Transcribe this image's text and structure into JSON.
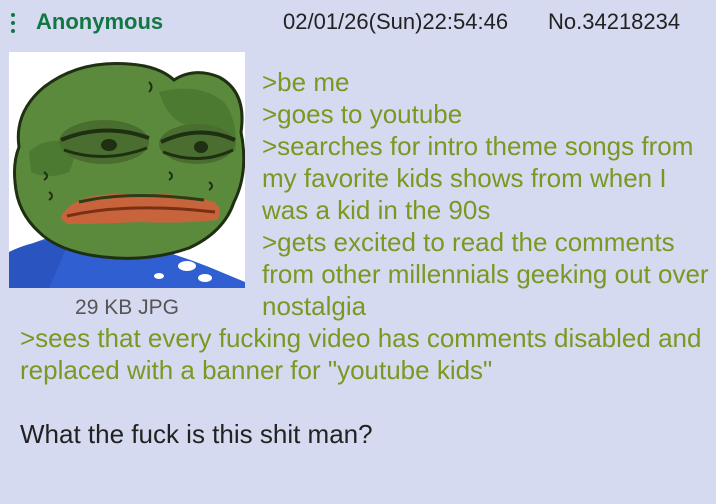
{
  "post": {
    "name": "Anonymous",
    "datetime": "02/01/26(Sun)22:54:46",
    "number": "No.34218234",
    "file_info": "29 KB JPG",
    "lines": [
      ">be me",
      ">goes to youtube",
      ">searches for intro theme songs from my favorite kids shows from when I was a kid in the 90s",
      ">gets excited to read the comments from other millennials geeking out over nostalgia",
      ">sees that every fucking video has comments disabled and replaced with a banner for \"youtube kids\""
    ],
    "closing": "What the fuck is this shit man?"
  },
  "colors": {
    "background": "#d6daf0",
    "name": "#117743",
    "greentext": "#789922",
    "text": "#222222"
  },
  "icons": {
    "menu": "vertical-dots-icon"
  }
}
